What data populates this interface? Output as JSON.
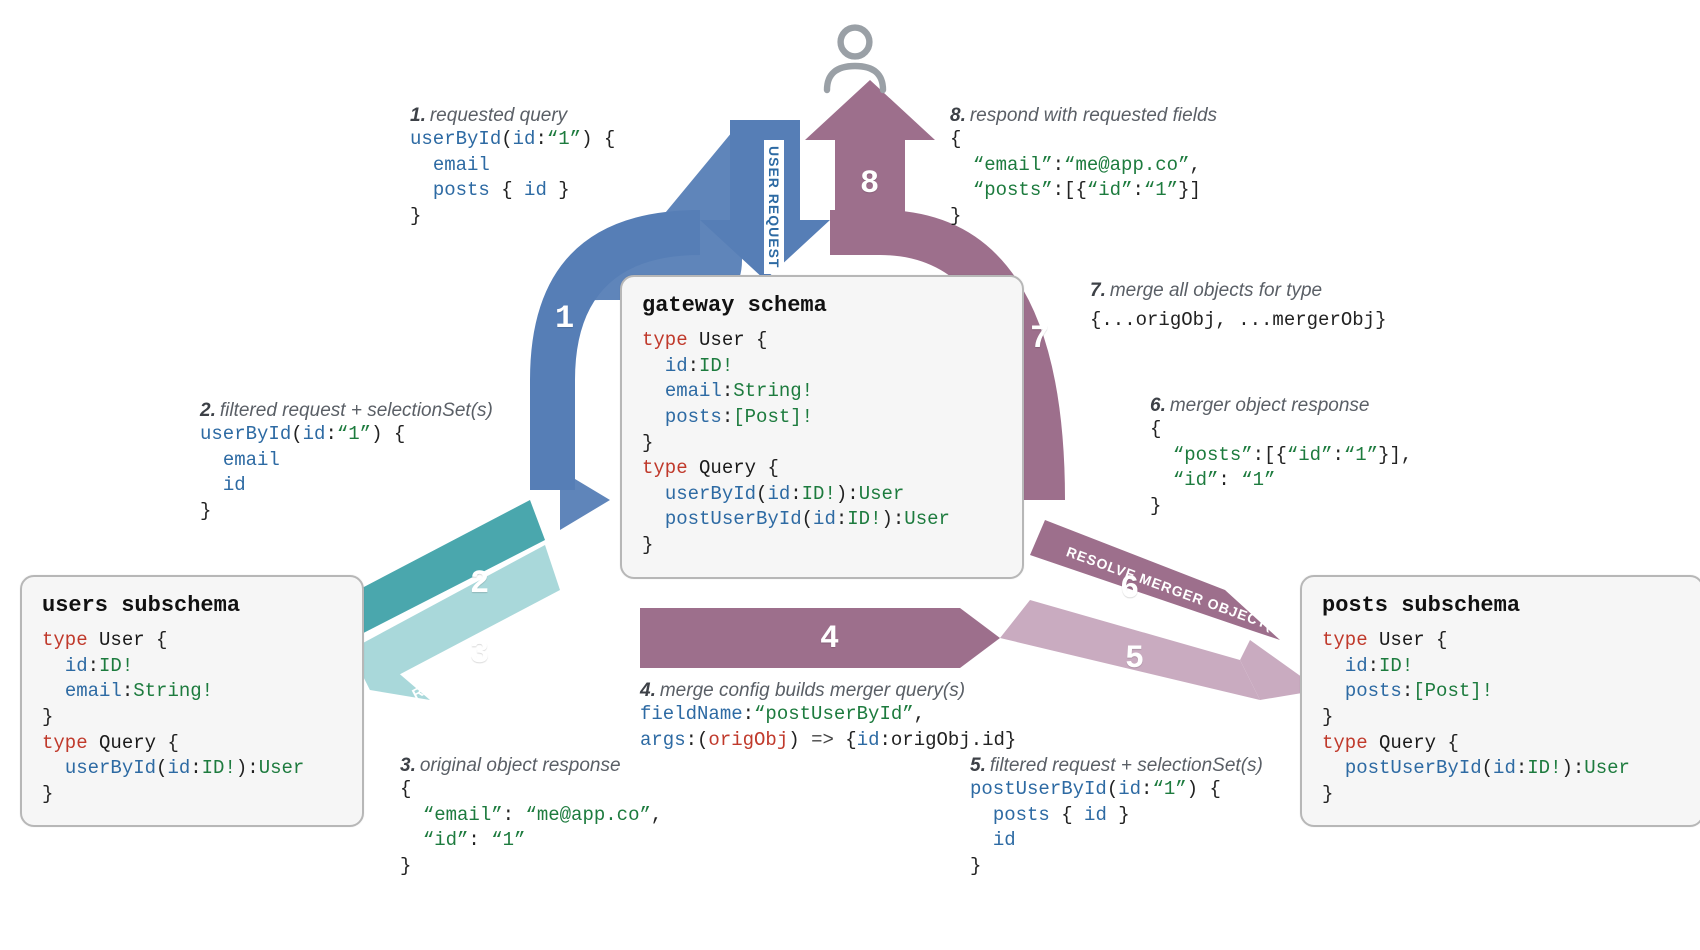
{
  "colors": {
    "blue_dark": "#567eb6",
    "blue_light": "#88a8cf",
    "teal_dark": "#4aa7ad",
    "teal_light": "#a9d8da",
    "mauve_dark": "#9d6f8c",
    "mauve_light": "#c9abc0",
    "user_icon": "#9aa0a6"
  },
  "labels": {
    "user_request": "USER REQUEST",
    "resolve_original": "RESOLVE ORIGINAL OBJECT",
    "resolve_merger": "RESOLVE MERGER OBJECT(S)"
  },
  "schemas": {
    "gateway": {
      "title": "gateway schema",
      "lines": [
        {
          "t": "type",
          "name": "User",
          "open": true
        },
        {
          "field": "id",
          "typ": "ID!"
        },
        {
          "field": "email",
          "typ": "String!"
        },
        {
          "field": "posts",
          "typ": "[Post]!"
        },
        {
          "close": true
        },
        {
          "t": "type",
          "name": "Query",
          "open": true
        },
        {
          "fn": "userById",
          "args": "id:ID!",
          "ret": "User"
        },
        {
          "fn": "postUserById",
          "args": "id:ID!",
          "ret": "User"
        },
        {
          "close": true
        }
      ]
    },
    "users": {
      "title": "users subschema",
      "lines": [
        {
          "t": "type",
          "name": "User",
          "open": true
        },
        {
          "field": "id",
          "typ": "ID!"
        },
        {
          "field": "email",
          "typ": "String!"
        },
        {
          "close": true
        },
        {
          "t": "type",
          "name": "Query",
          "open": true
        },
        {
          "fn": "userById",
          "args": "id:ID!",
          "ret": "User"
        },
        {
          "close": true
        }
      ]
    },
    "posts": {
      "title": "posts subschema",
      "lines": [
        {
          "t": "type",
          "name": "User",
          "open": true
        },
        {
          "field": "id",
          "typ": "ID!"
        },
        {
          "field": "posts",
          "typ": "[Post]!"
        },
        {
          "close": true
        },
        {
          "t": "type",
          "name": "Query",
          "open": true
        },
        {
          "fn": "postUserById",
          "args": "id:ID!",
          "ret": "User"
        },
        {
          "close": true
        }
      ]
    }
  },
  "steps": {
    "s1": {
      "num": "1.",
      "caption": "requested query",
      "code_html": "<span class='qc'>userById</span>(<span class='fn'>id</span>:<span class='str'>“1”</span>) <span class='brace'>{</span>\n  <span class='fn'>email</span>\n  <span class='fn'>posts</span> <span class='brace'>{</span> <span class='fn'>id</span> <span class='brace'>}</span>\n<span class='brace'>}</span>"
    },
    "s2": {
      "num": "2.",
      "caption": "filtered request + selectionSet(s)",
      "code_html": "<span class='qc'>userById</span>(<span class='fn'>id</span>:<span class='str'>“1”</span>) <span class='brace'>{</span>\n  <span class='fn'>email</span>\n  <span class='fn'>id</span>\n<span class='brace'>}</span>"
    },
    "s3": {
      "num": "3.",
      "caption": "original object response",
      "code_html": "<span class='brace'>{</span>\n  <span class='str'>“email”</span>: <span class='str'>“me@app.co”</span>,\n  <span class='str'>“id”</span>: <span class='str'>“1”</span>\n<span class='brace'>}</span>"
    },
    "s4": {
      "num": "4.",
      "caption": "merge config builds merger query(s)",
      "code_html": "<span class='fn'>fieldName</span>:<span class='str'>“postUserById”</span>,\n<span class='fn'>args</span>:(<span class='kw'>origObj</span>) <span class='args'>=&gt;</span> <span class='brace'>{</span><span class='fn'>id</span>:origObj.id<span class='brace'>}</span>"
    },
    "s5": {
      "num": "5.",
      "caption": "filtered request + selectionSet(s)",
      "code_html": "<span class='qc'>postUserById</span>(<span class='fn'>id</span>:<span class='str'>“1”</span>) <span class='brace'>{</span>\n  <span class='fn'>posts</span> <span class='brace'>{</span> <span class='fn'>id</span> <span class='brace'>}</span>\n  <span class='fn'>id</span>\n<span class='brace'>}</span>"
    },
    "s6": {
      "num": "6.",
      "caption": "merger object response",
      "code_html": "<span class='brace'>{</span>\n  <span class='str'>“posts”</span>:<span class='brace'>[{</span><span class='str'>“id”</span>:<span class='str'>“1”</span><span class='brace'>}]</span>,\n  <span class='str'>“id”</span>: <span class='str'>“1”</span>\n<span class='brace'>}</span>"
    },
    "s7": {
      "num": "7.",
      "caption": "merge all objects for type",
      "code_html": "<span class='brace'>{</span>...origObj, ...mergerObj<span class='brace'>}</span>"
    },
    "s8": {
      "num": "8.",
      "caption": "respond with requested fields",
      "code_html": "<span class='brace'>{</span>\n  <span class='str'>“email”</span>:<span class='str'>“me@app.co”</span>,\n  <span class='str'>“posts”</span>:<span class='brace'>[{</span><span class='str'>“id”</span>:<span class='str'>“1”</span><span class='brace'>}]</span>\n<span class='brace'>}</span>"
    }
  },
  "stepnums": {
    "n1": "1",
    "n2": "2",
    "n3": "3",
    "n4": "4",
    "n5": "5",
    "n6": "6",
    "n7": "7",
    "n8": "8"
  }
}
